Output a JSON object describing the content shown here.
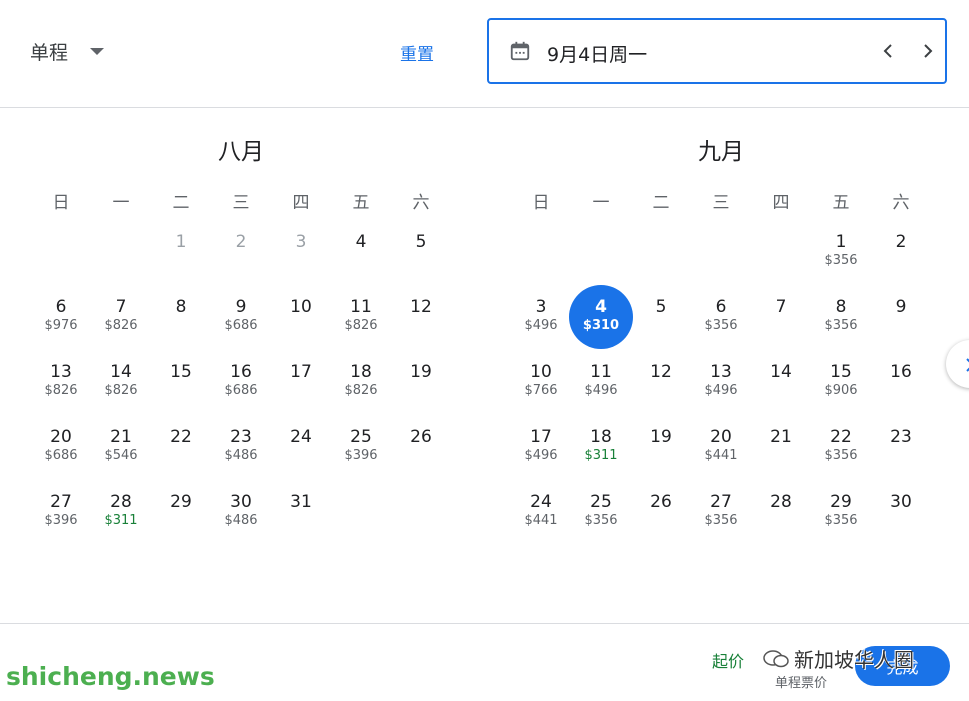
{
  "header": {
    "trip_type": "单程",
    "reset_label": "重置",
    "date_value": "9月4日周一"
  },
  "weekdays": [
    "日",
    "一",
    "二",
    "三",
    "四",
    "五",
    "六"
  ],
  "months": [
    {
      "title": "八月",
      "offset": 2,
      "days": [
        {
          "n": "1",
          "p": "",
          "disabled": true
        },
        {
          "n": "2",
          "p": "",
          "disabled": true
        },
        {
          "n": "3",
          "p": "",
          "disabled": true
        },
        {
          "n": "4",
          "p": ""
        },
        {
          "n": "5",
          "p": ""
        },
        {
          "n": "6",
          "p": "$976"
        },
        {
          "n": "7",
          "p": "$826"
        },
        {
          "n": "8",
          "p": ""
        },
        {
          "n": "9",
          "p": "$686"
        },
        {
          "n": "10",
          "p": ""
        },
        {
          "n": "11",
          "p": "$826"
        },
        {
          "n": "12",
          "p": ""
        },
        {
          "n": "13",
          "p": "$826"
        },
        {
          "n": "14",
          "p": "$826"
        },
        {
          "n": "15",
          "p": ""
        },
        {
          "n": "16",
          "p": "$686"
        },
        {
          "n": "17",
          "p": ""
        },
        {
          "n": "18",
          "p": "$826"
        },
        {
          "n": "19",
          "p": ""
        },
        {
          "n": "20",
          "p": "$686"
        },
        {
          "n": "21",
          "p": "$546"
        },
        {
          "n": "22",
          "p": ""
        },
        {
          "n": "23",
          "p": "$486"
        },
        {
          "n": "24",
          "p": ""
        },
        {
          "n": "25",
          "p": "$396"
        },
        {
          "n": "26",
          "p": ""
        },
        {
          "n": "27",
          "p": "$396"
        },
        {
          "n": "28",
          "p": "$311",
          "low": true
        },
        {
          "n": "29",
          "p": ""
        },
        {
          "n": "30",
          "p": "$486"
        },
        {
          "n": "31",
          "p": ""
        }
      ]
    },
    {
      "title": "九月",
      "offset": 5,
      "days": [
        {
          "n": "1",
          "p": "$356"
        },
        {
          "n": "2",
          "p": ""
        },
        {
          "n": "3",
          "p": "$496"
        },
        {
          "n": "4",
          "p": "$310",
          "selected": true
        },
        {
          "n": "5",
          "p": ""
        },
        {
          "n": "6",
          "p": "$356"
        },
        {
          "n": "7",
          "p": ""
        },
        {
          "n": "8",
          "p": "$356"
        },
        {
          "n": "9",
          "p": ""
        },
        {
          "n": "10",
          "p": "$766"
        },
        {
          "n": "11",
          "p": "$496"
        },
        {
          "n": "12",
          "p": ""
        },
        {
          "n": "13",
          "p": "$496"
        },
        {
          "n": "14",
          "p": ""
        },
        {
          "n": "15",
          "p": "$906"
        },
        {
          "n": "16",
          "p": ""
        },
        {
          "n": "17",
          "p": "$496"
        },
        {
          "n": "18",
          "p": "$311",
          "low": true
        },
        {
          "n": "19",
          "p": ""
        },
        {
          "n": "20",
          "p": "$441"
        },
        {
          "n": "21",
          "p": ""
        },
        {
          "n": "22",
          "p": "$356"
        },
        {
          "n": "23",
          "p": ""
        },
        {
          "n": "24",
          "p": "$441"
        },
        {
          "n": "25",
          "p": "$356"
        },
        {
          "n": "26",
          "p": ""
        },
        {
          "n": "27",
          "p": "$356"
        },
        {
          "n": "28",
          "p": ""
        },
        {
          "n": "29",
          "p": "$356"
        },
        {
          "n": "30",
          "p": ""
        }
      ]
    }
  ],
  "footer": {
    "from_price": "起价",
    "price_note": "单程票价",
    "done_label": "完成"
  },
  "watermarks": {
    "left": "shicheng.news",
    "right": "新加坡华人圈"
  },
  "colors": {
    "accent": "#1a73e8",
    "low_price": "#188038"
  }
}
